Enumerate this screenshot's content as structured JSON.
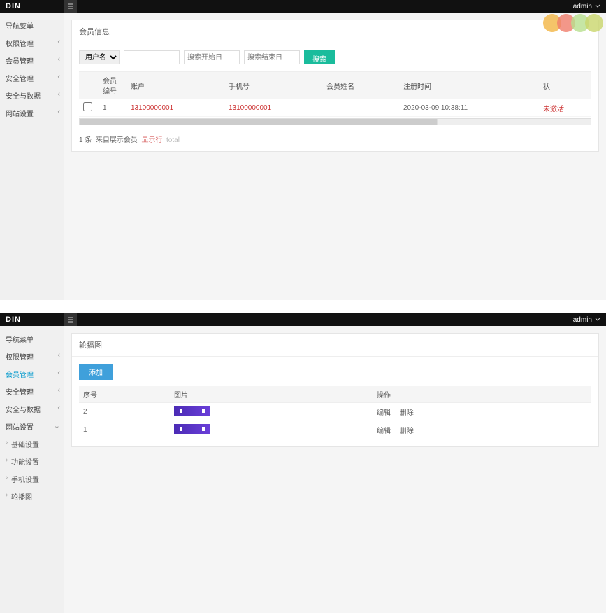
{
  "app": {
    "brand": "DIN",
    "admin_label": "admin"
  },
  "screen1": {
    "nav": [
      {
        "label": "导航菜单",
        "sub": false,
        "active": false
      },
      {
        "label": "权限管理",
        "sub": true,
        "active": false
      },
      {
        "label": "会员管理",
        "sub": true,
        "active": false
      },
      {
        "label": "安全管理",
        "sub": true,
        "active": false
      },
      {
        "label": "安全与数据",
        "sub": true,
        "active": false
      },
      {
        "label": "网站设置",
        "sub": true,
        "active": false
      }
    ],
    "panel_title": "会员信息",
    "search": {
      "select_label": "用户名",
      "ph1": "",
      "ph2": "搜索开始日",
      "ph3": "搜索结束日",
      "btn": "搜索"
    },
    "columns": [
      "",
      "会员编号",
      "账户",
      "手机号",
      "会员姓名",
      "注册时间",
      "状"
    ],
    "rows": [
      {
        "id": "1",
        "account": "13100000001",
        "phone": "13100000001",
        "name": "",
        "date": "2020-03-09 10:38:11",
        "status": "未激活"
      }
    ],
    "summary": {
      "prefix": "1 条",
      "mid": "来自展示会员",
      "suffix": "显示行",
      "tail": "total"
    }
  },
  "screen2": {
    "nav": {
      "items": [
        {
          "label": "导航菜单",
          "sub": false,
          "active": false
        },
        {
          "label": "权限管理",
          "sub": true,
          "active": false
        },
        {
          "label": "会员管理",
          "sub": true,
          "active": true
        },
        {
          "label": "安全管理",
          "sub": true,
          "active": false
        },
        {
          "label": "安全与数据",
          "sub": true,
          "active": false
        },
        {
          "label": "网站设置",
          "sub": true,
          "active": false,
          "expanded": true
        }
      ],
      "subs": [
        {
          "label": "基础设置"
        },
        {
          "label": "功能设置"
        },
        {
          "label": "手机设置"
        },
        {
          "label": "轮播图"
        }
      ]
    },
    "panel_title": "轮播图",
    "add_btn": "添加",
    "columns": [
      "序号",
      "图片",
      "操作"
    ],
    "ops": {
      "edit": "编辑",
      "del": "删除"
    },
    "rows": [
      {
        "seq": "2"
      },
      {
        "seq": "1"
      }
    ]
  }
}
